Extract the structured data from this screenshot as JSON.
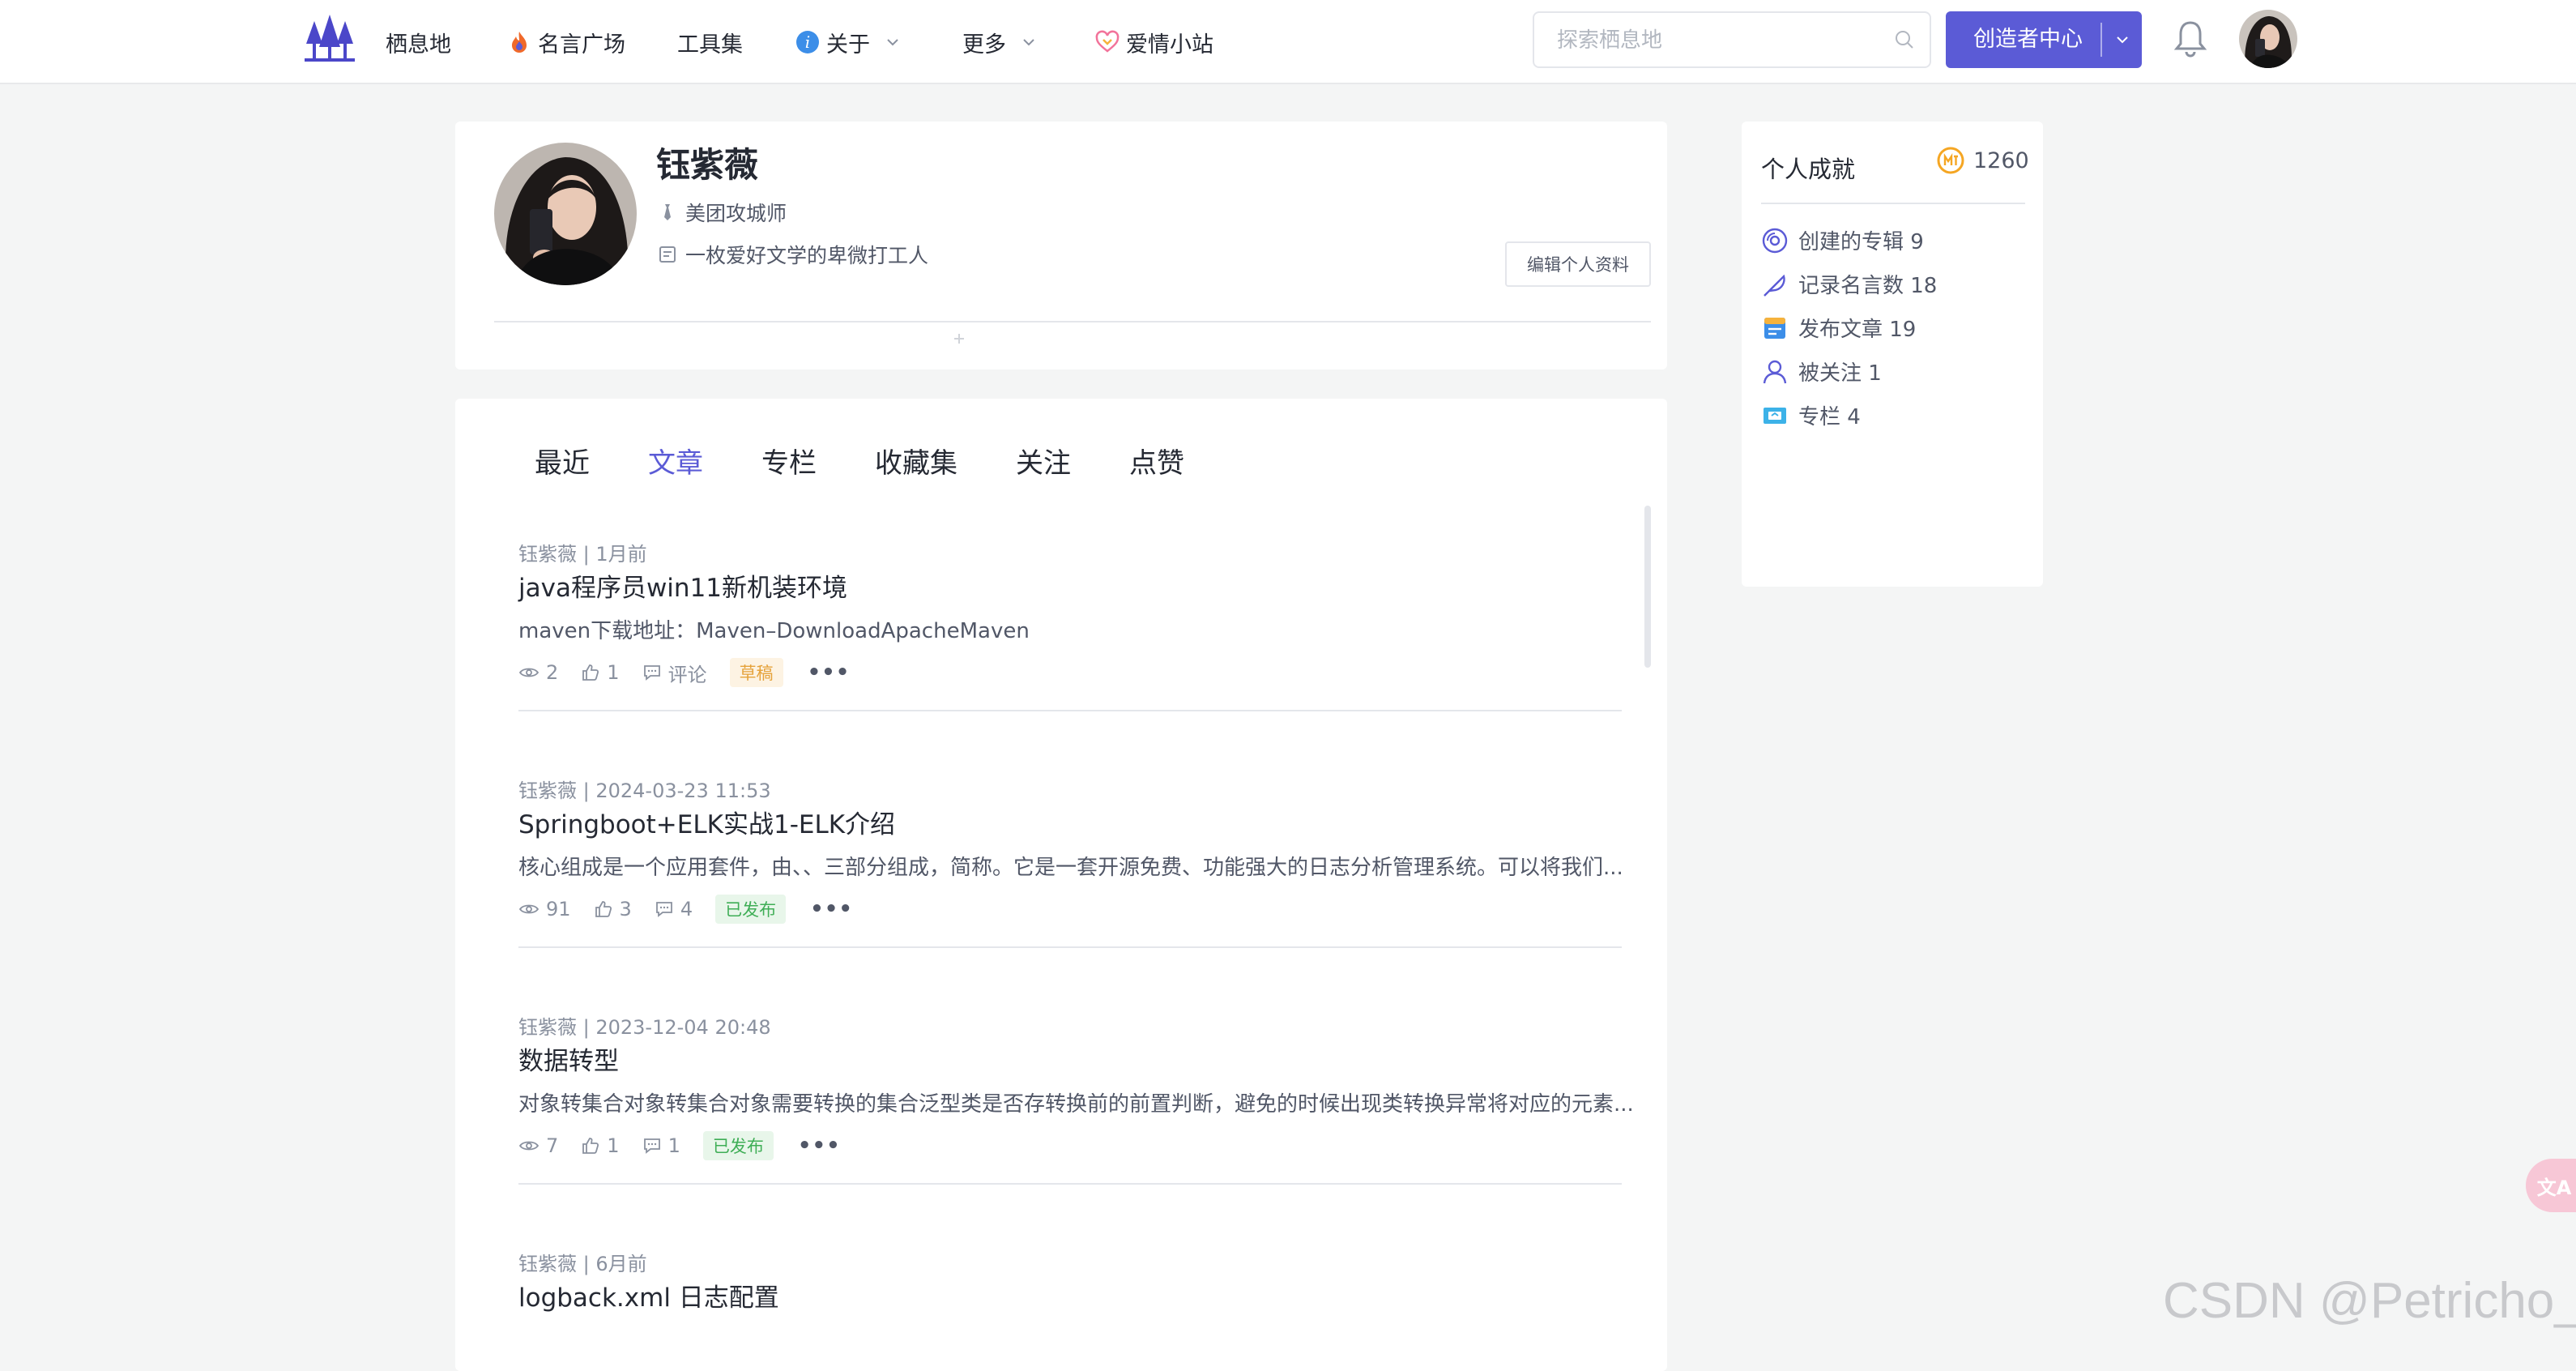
{
  "nav": {
    "items": [
      {
        "label": "栖息地"
      },
      {
        "label": "名言广场"
      },
      {
        "label": "工具集"
      },
      {
        "label": "关于"
      },
      {
        "label": "更多"
      },
      {
        "label": "爱情小站"
      }
    ],
    "search_placeholder": "探索栖息地",
    "creator_label": "创造者中心"
  },
  "profile": {
    "name": "钰紫薇",
    "job": "美团攻城师",
    "bio": "一枚爱好文学的卑微打工人",
    "edit_label": "编辑个人资料"
  },
  "tabs": [
    {
      "label": "最近"
    },
    {
      "label": "文章",
      "active": true
    },
    {
      "label": "专栏"
    },
    {
      "label": "收藏集"
    },
    {
      "label": "关注"
    },
    {
      "label": "点赞"
    }
  ],
  "articles": [
    {
      "meta": "钰紫薇 | 1月前",
      "title": "java程序员win11新机装环境",
      "excerpt": "maven下载地址：Maven–DownloadApacheMaven",
      "views": "2",
      "likes": "1",
      "comments": "评论",
      "status": "草稿",
      "more": "•••"
    },
    {
      "meta": "钰紫薇 | 2024-03-23 11:53",
      "title": "Springboot+ELK实战1-ELK介绍",
      "excerpt": "核心组成是一个应用套件，由、、三部分组成，简称。它是一套开源免费、功能强大的日志分析管理系统。可以将我们...",
      "views": "91",
      "likes": "3",
      "comments": "4",
      "status": "已发布",
      "more": "•••"
    },
    {
      "meta": "钰紫薇 | 2023-12-04 20:48",
      "title": "数据转型",
      "excerpt": "对象转集合对象转集合对象需要转换的集合泛型类是否存转换前的前置判断，避免的时候出现类转换异常将对应的元素...",
      "views": "7",
      "likes": "1",
      "comments": "1",
      "status": "已发布",
      "more": "•••"
    },
    {
      "meta": "钰紫薇 | 6月前",
      "title": "logback.xml 日志配置"
    }
  ],
  "achievements": {
    "title": "个人成就",
    "score": "1260",
    "items": [
      {
        "label": "创建的专辑 9"
      },
      {
        "label": "记录名言数 18"
      },
      {
        "label": "发布文章 19"
      },
      {
        "label": "被关注 1"
      },
      {
        "label": "专栏 4"
      }
    ]
  },
  "translate_label": "文A",
  "watermark": "CSDN @Petricho_r",
  "colors": {
    "accent": "#5b5bd6",
    "draft": "#e5a23a",
    "published": "#3fae56"
  }
}
